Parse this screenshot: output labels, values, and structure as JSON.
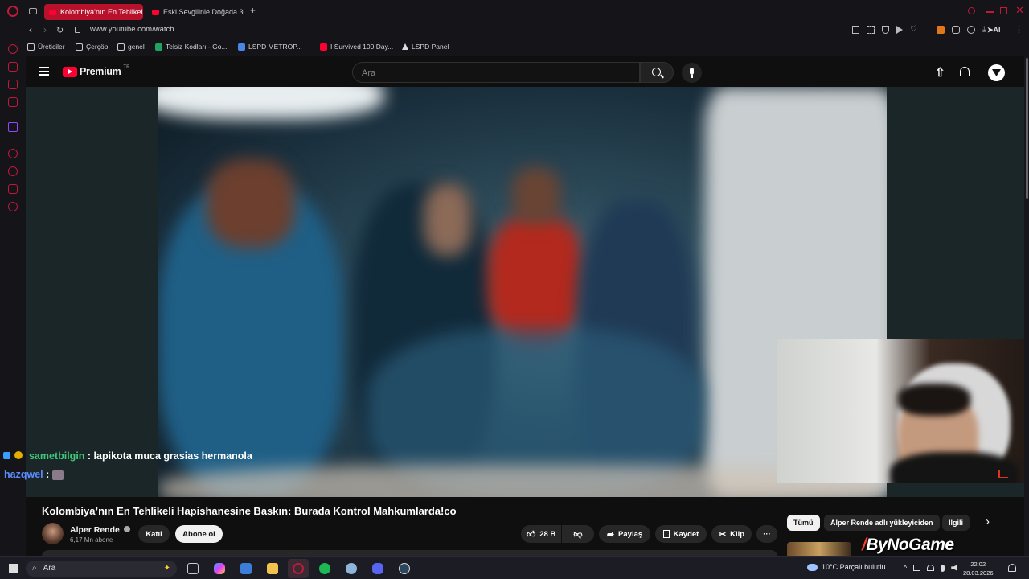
{
  "browser": {
    "tabs": [
      {
        "label": "Kolombiya’nın En Tehlikeli",
        "active": true
      },
      {
        "label": "Eski Sevgilinle Doğada 30",
        "active": false
      }
    ],
    "address": "www.youtube.com/watch",
    "ai_label": "AI",
    "bookmarks": [
      {
        "label": "Üreticiler",
        "icon": "folder-icon"
      },
      {
        "label": "Çerçöp",
        "icon": "folder-icon"
      },
      {
        "label": "genel",
        "icon": "folder-icon"
      },
      {
        "label": "Telsiz Kodları - Go...",
        "icon": "sheets-icon"
      },
      {
        "label": "LSPD METROP...",
        "icon": "docs-icon"
      },
      {
        "label": "I Survived 100 Day...",
        "icon": "youtube-icon"
      },
      {
        "label": "LSPD Panel",
        "icon": "triangle-icon"
      }
    ]
  },
  "youtube": {
    "logo_text": "Premium",
    "logo_region": "TR",
    "search_placeholder": "Ara",
    "video_title": "Kolombiya’nın En Tehlikeli Hapishanesine Baskın: Burada Kontrol Mahkumlarda!co",
    "channel": {
      "name": "Alper Rende",
      "subscribers": "6,17 Mn abone"
    },
    "buttons": {
      "join": "Katıl",
      "subscribe": "Abone ol",
      "likes": "28 B",
      "share": "Paylaş",
      "save": "Kaydet",
      "clip": "Klip"
    },
    "chips": [
      "Tümü",
      "Alper Rende adlı yükleyiciden",
      "İlgili"
    ]
  },
  "chat": [
    {
      "user": "sametbilgin",
      "message": ": lapikota muca grasias hermanola",
      "user_color": "#3ec97a"
    },
    {
      "user": "hazqwel",
      "message": ":",
      "user_color": "#5b8cff"
    }
  ],
  "overlay": {
    "watermark": "ByNoGame"
  },
  "taskbar": {
    "search_placeholder": "Ara",
    "weather": "10°C  Parçalı bulutlu",
    "time": "22:02",
    "date": "28.03.2026"
  },
  "colors": {
    "accent": "#b8112b",
    "subscribe_bg": "#f1f1f1",
    "youtube_red": "#ff0033"
  }
}
